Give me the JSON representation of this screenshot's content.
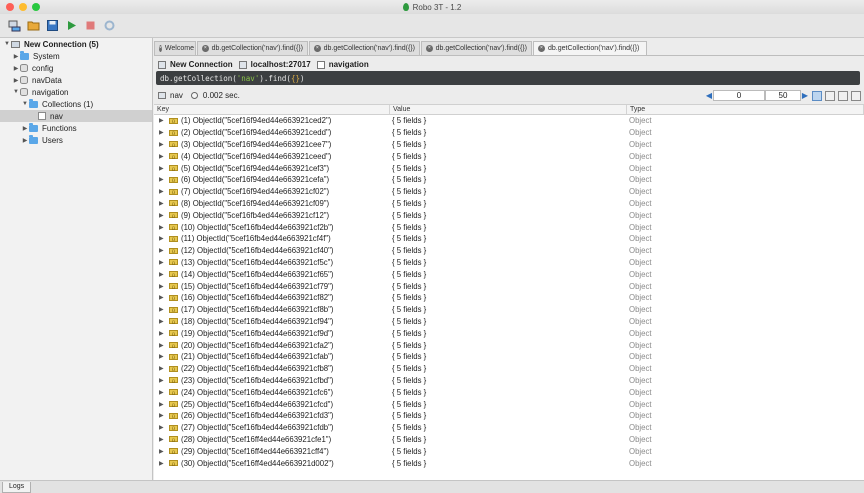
{
  "window": {
    "title": "Robo 3T - 1.2"
  },
  "toolbar": {
    "buttons": [
      "connect-icon",
      "open-icon",
      "save-icon",
      "execute-icon",
      "stop-icon",
      "refresh-icon"
    ]
  },
  "sidebar": {
    "connection": "New Connection (5)",
    "items": [
      {
        "label": "System",
        "kind": "folder",
        "level": 1,
        "expanded": false
      },
      {
        "label": "config",
        "kind": "db",
        "level": 1,
        "expanded": false
      },
      {
        "label": "navData",
        "kind": "db",
        "level": 1,
        "expanded": false
      },
      {
        "label": "navigation",
        "kind": "db",
        "level": 1,
        "expanded": true
      },
      {
        "label": "Collections (1)",
        "kind": "folder",
        "level": 2,
        "expanded": true
      },
      {
        "label": "nav",
        "kind": "collection",
        "level": 3,
        "expanded": false,
        "selected": true
      },
      {
        "label": "Functions",
        "kind": "folder",
        "level": 2,
        "expanded": false
      },
      {
        "label": "Users",
        "kind": "folder",
        "level": 2,
        "expanded": false
      }
    ]
  },
  "tabs": [
    {
      "label": "Welcome",
      "active": false
    },
    {
      "label": "db.getCollection('nav').find({})",
      "active": false
    },
    {
      "label": "db.getCollection('nav').find({})",
      "active": false
    },
    {
      "label": "db.getCollection('nav').find({})",
      "active": false
    },
    {
      "label": "db.getCollection('nav').find({})",
      "active": true
    }
  ],
  "breadcrumb": {
    "connection": "New Connection",
    "host": "localhost:27017",
    "database": "navigation"
  },
  "query": {
    "prefix": "db.getCollection(",
    "collection": "'nav'",
    "middle": ").find(",
    "args": "{}",
    "suffix": ")"
  },
  "result": {
    "collection": "nav",
    "time": "0.002 sec.",
    "skip": "0",
    "limit": "50"
  },
  "grid": {
    "headers": {
      "key": "Key",
      "value": "Value",
      "type": "Type"
    },
    "rows": [
      {
        "key": "(1) ObjectId(\"5cef16f94ed44e663921ced2\")",
        "value": "{ 5 fields }",
        "type": "Object"
      },
      {
        "key": "(2) ObjectId(\"5cef16f94ed44e663921cedd\")",
        "value": "{ 5 fields }",
        "type": "Object"
      },
      {
        "key": "(3) ObjectId(\"5cef16f94ed44e663921cee7\")",
        "value": "{ 5 fields }",
        "type": "Object"
      },
      {
        "key": "(4) ObjectId(\"5cef16f94ed44e663921ceed\")",
        "value": "{ 5 fields }",
        "type": "Object"
      },
      {
        "key": "(5) ObjectId(\"5cef16f94ed44e663921cef3\")",
        "value": "{ 5 fields }",
        "type": "Object"
      },
      {
        "key": "(6) ObjectId(\"5cef16f94ed44e663921cefa\")",
        "value": "{ 5 fields }",
        "type": "Object"
      },
      {
        "key": "(7) ObjectId(\"5cef16f94ed44e663921cf02\")",
        "value": "{ 5 fields }",
        "type": "Object"
      },
      {
        "key": "(8) ObjectId(\"5cef16f94ed44e663921cf09\")",
        "value": "{ 5 fields }",
        "type": "Object"
      },
      {
        "key": "(9) ObjectId(\"5cef16fb4ed44e663921cf12\")",
        "value": "{ 5 fields }",
        "type": "Object"
      },
      {
        "key": "(10) ObjectId(\"5cef16fb4ed44e663921cf2b\")",
        "value": "{ 5 fields }",
        "type": "Object"
      },
      {
        "key": "(11) ObjectId(\"5cef16fb4ed44e663921cf4f\")",
        "value": "{ 5 fields }",
        "type": "Object"
      },
      {
        "key": "(12) ObjectId(\"5cef16fb4ed44e663921cf40\")",
        "value": "{ 5 fields }",
        "type": "Object"
      },
      {
        "key": "(13) ObjectId(\"5cef16fb4ed44e663921cf5c\")",
        "value": "{ 5 fields }",
        "type": "Object"
      },
      {
        "key": "(14) ObjectId(\"5cef16fb4ed44e663921cf65\")",
        "value": "{ 5 fields }",
        "type": "Object"
      },
      {
        "key": "(15) ObjectId(\"5cef16fb4ed44e663921cf79\")",
        "value": "{ 5 fields }",
        "type": "Object"
      },
      {
        "key": "(16) ObjectId(\"5cef16fb4ed44e663921cf82\")",
        "value": "{ 5 fields }",
        "type": "Object"
      },
      {
        "key": "(17) ObjectId(\"5cef16fb4ed44e663921cf8b\")",
        "value": "{ 5 fields }",
        "type": "Object"
      },
      {
        "key": "(18) ObjectId(\"5cef16fb4ed44e663921cf94\")",
        "value": "{ 5 fields }",
        "type": "Object"
      },
      {
        "key": "(19) ObjectId(\"5cef16fb4ed44e663921cf9d\")",
        "value": "{ 5 fields }",
        "type": "Object"
      },
      {
        "key": "(20) ObjectId(\"5cef16fb4ed44e663921cfa2\")",
        "value": "{ 5 fields }",
        "type": "Object"
      },
      {
        "key": "(21) ObjectId(\"5cef16fb4ed44e663921cfab\")",
        "value": "{ 5 fields }",
        "type": "Object"
      },
      {
        "key": "(22) ObjectId(\"5cef16fb4ed44e663921cfb8\")",
        "value": "{ 5 fields }",
        "type": "Object"
      },
      {
        "key": "(23) ObjectId(\"5cef16fb4ed44e663921cfbd\")",
        "value": "{ 5 fields }",
        "type": "Object"
      },
      {
        "key": "(24) ObjectId(\"5cef16fb4ed44e663921cfc6\")",
        "value": "{ 5 fields }",
        "type": "Object"
      },
      {
        "key": "(25) ObjectId(\"5cef16fb4ed44e663921cfcd\")",
        "value": "{ 5 fields }",
        "type": "Object"
      },
      {
        "key": "(26) ObjectId(\"5cef16fb4ed44e663921cfd3\")",
        "value": "{ 5 fields }",
        "type": "Object"
      },
      {
        "key": "(27) ObjectId(\"5cef16fb4ed44e663921cfdb\")",
        "value": "{ 5 fields }",
        "type": "Object"
      },
      {
        "key": "(28) ObjectId(\"5cef16ff4ed44e663921cfe1\")",
        "value": "{ 5 fields }",
        "type": "Object"
      },
      {
        "key": "(29) ObjectId(\"5cef16ff4ed44e663921cff4\")",
        "value": "{ 5 fields }",
        "type": "Object"
      },
      {
        "key": "(30) ObjectId(\"5cef16ff4ed44e663921d002\")",
        "value": "{ 5 fields }",
        "type": "Object"
      }
    ]
  },
  "status": {
    "logs_label": "Logs"
  },
  "colors": {
    "accent": "#2f6fbd",
    "query_bg": "#3c3f41",
    "selection": "#d0d0d0",
    "close": "#fe5f57",
    "minimize": "#febc2e",
    "maximize": "#28c840"
  }
}
